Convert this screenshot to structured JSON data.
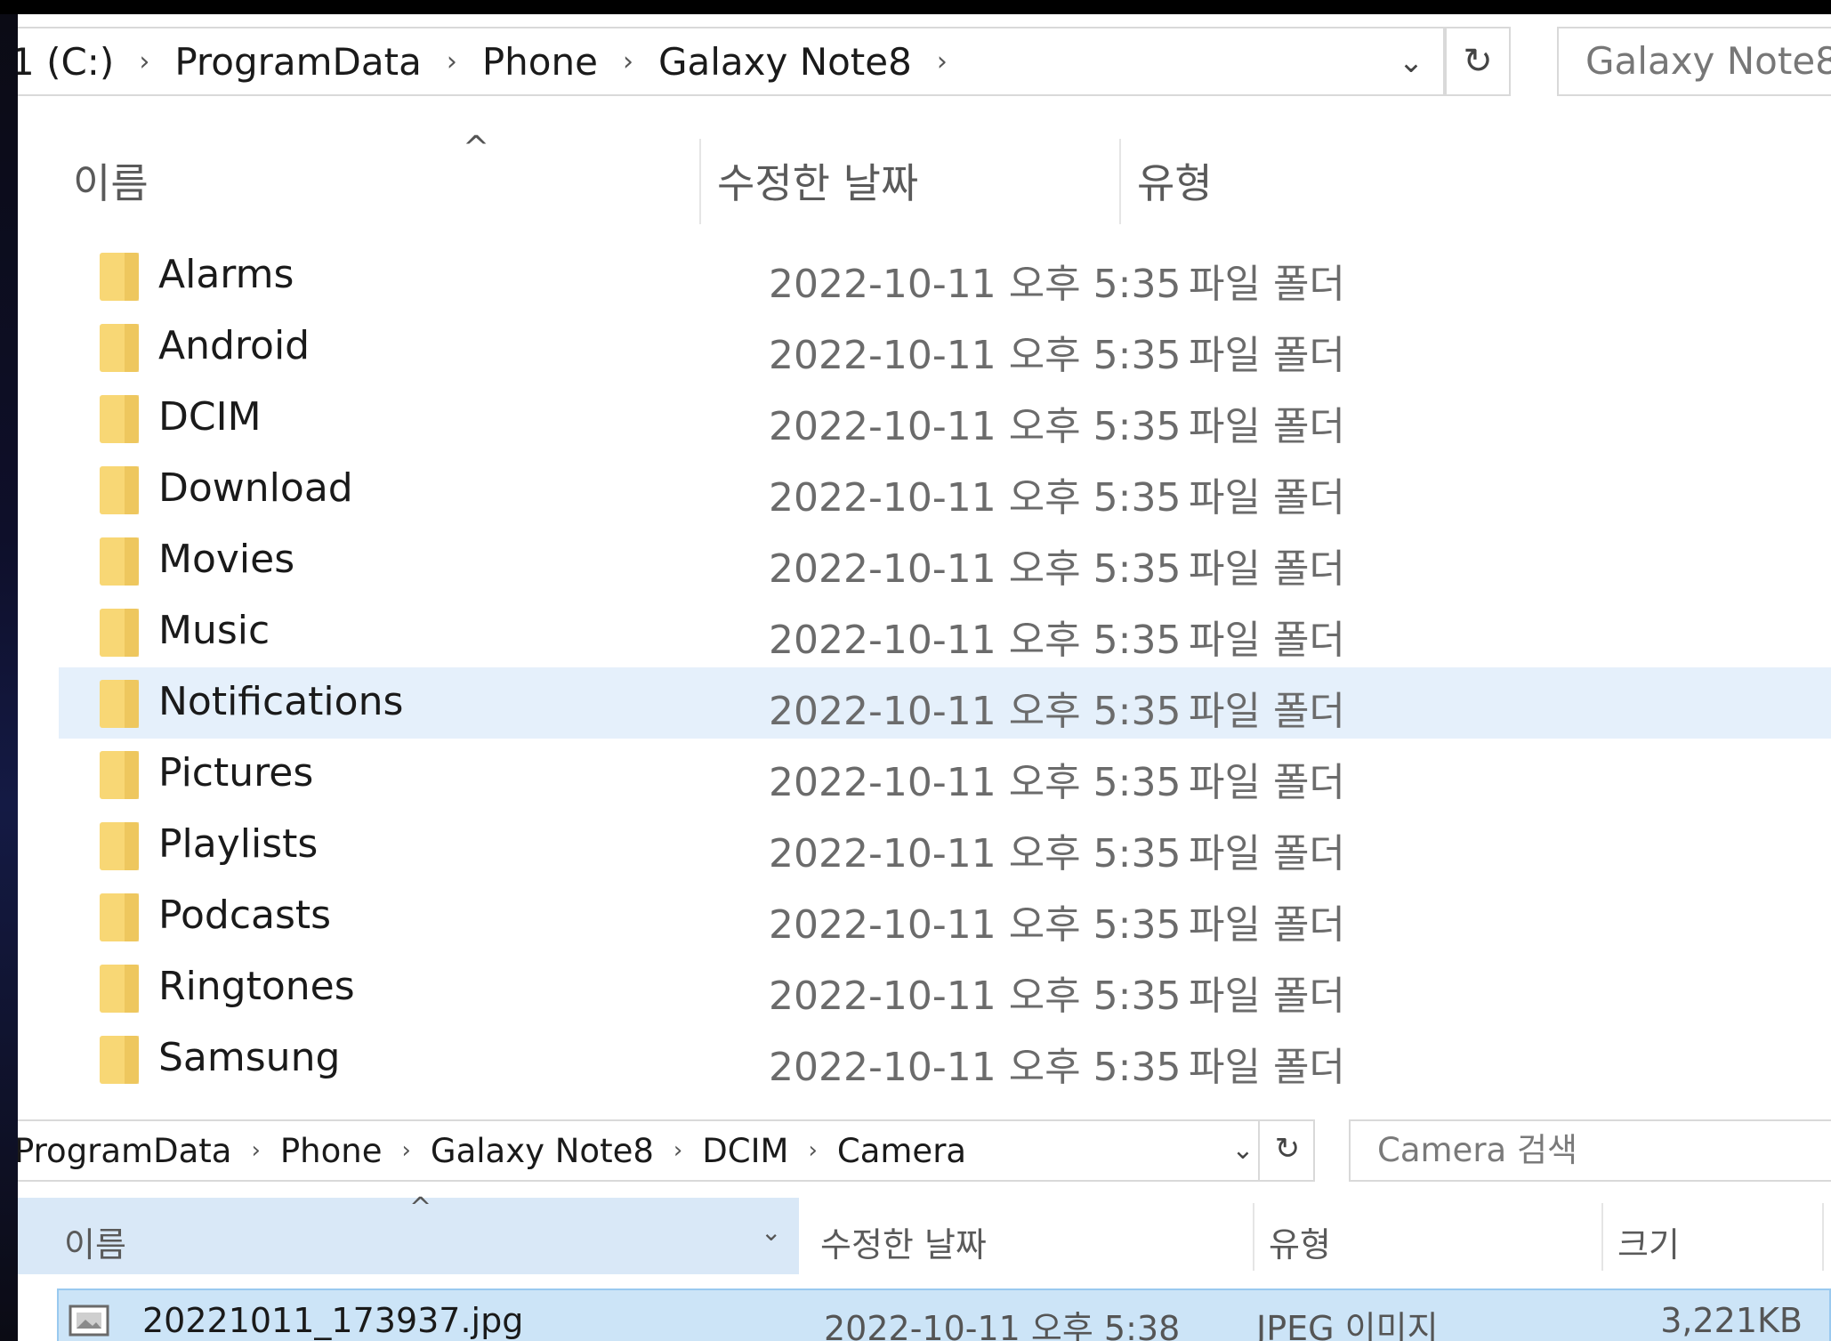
{
  "top_explorer": {
    "breadcrumbs": [
      "1 (C:)",
      "ProgramData",
      "Phone",
      "Galaxy Note8"
    ],
    "breadcrumb_separator": "›",
    "dropdown_glyph": "⌄",
    "refresh_glyph": "↻",
    "search_text": "Galaxy Note8",
    "columns": {
      "name": "이름",
      "modified": "수정한 날짜",
      "type": "유형"
    },
    "sort_indicator": "^",
    "rows": [
      {
        "name": "Alarms",
        "modified": "2022-10-11 오후 5:35",
        "type": "파일 폴더"
      },
      {
        "name": "Android",
        "modified": "2022-10-11 오후 5:35",
        "type": "파일 폴더"
      },
      {
        "name": "DCIM",
        "modified": "2022-10-11 오후 5:35",
        "type": "파일 폴더"
      },
      {
        "name": "Download",
        "modified": "2022-10-11 오후 5:35",
        "type": "파일 폴더"
      },
      {
        "name": "Movies",
        "modified": "2022-10-11 오후 5:35",
        "type": "파일 폴더"
      },
      {
        "name": "Music",
        "modified": "2022-10-11 오후 5:35",
        "type": "파일 폴더"
      },
      {
        "name": "Notifications",
        "modified": "2022-10-11 오후 5:35",
        "type": "파일 폴더",
        "selected": true
      },
      {
        "name": "Pictures",
        "modified": "2022-10-11 오후 5:35",
        "type": "파일 폴더"
      },
      {
        "name": "Playlists",
        "modified": "2022-10-11 오후 5:35",
        "type": "파일 폴더"
      },
      {
        "name": "Podcasts",
        "modified": "2022-10-11 오후 5:35",
        "type": "파일 폴더"
      },
      {
        "name": "Ringtones",
        "modified": "2022-10-11 오후 5:35",
        "type": "파일 폴더"
      },
      {
        "name": "Samsung",
        "modified": "2022-10-11 오후 5:35",
        "type": "파일 폴더"
      }
    ]
  },
  "bottom_explorer": {
    "breadcrumbs": [
      "ProgramData",
      "Phone",
      "Galaxy Note8",
      "DCIM",
      "Camera"
    ],
    "search_placeholder": "Camera 검색",
    "columns": {
      "name": "이름",
      "modified": "수정한 날짜",
      "type": "유형",
      "size": "크기"
    },
    "name_dropdown_glyph": "⌄",
    "file": {
      "name": "20221011_173937.jpg",
      "modified": "2022-10-11 오후 5:38",
      "type": "JPEG 이미지",
      "size": "3,221KB"
    }
  },
  "colors": {
    "selected_row": "#e5f0fb",
    "bottom_selected_row": "#cce4f7",
    "bottom_selected_border": "#99c9ef",
    "name_header_highlight": "#d9e8f7",
    "folder_yellow": "#f8d775",
    "folder_yellow_dark": "#e6b94a"
  }
}
